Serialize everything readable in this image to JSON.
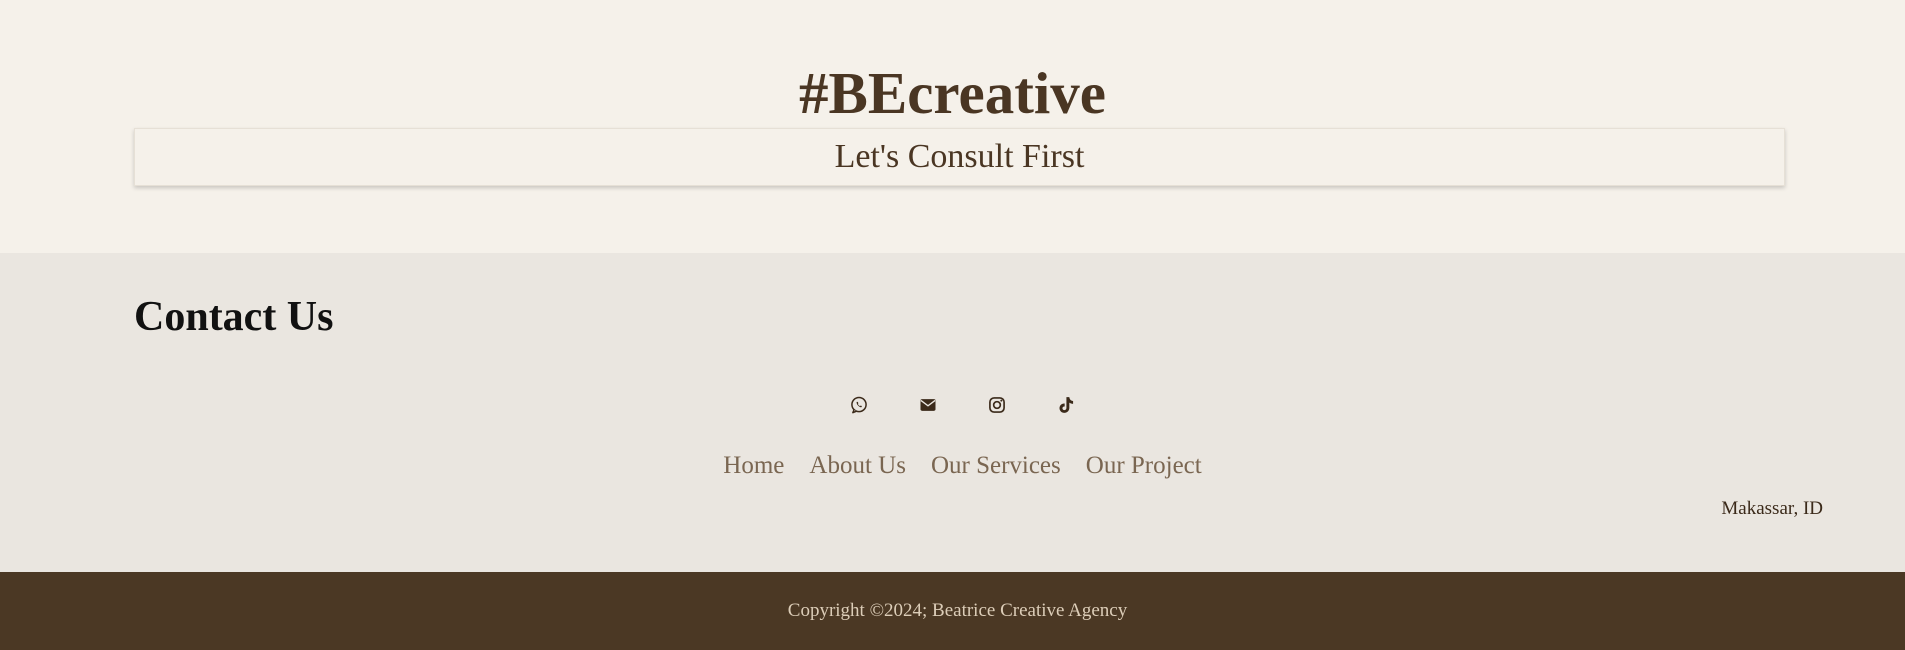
{
  "hero": {
    "title": "#BEcreative",
    "cta_label": "Let's Consult First"
  },
  "contact": {
    "heading": "Contact Us",
    "social": [
      {
        "icon": "whatsapp-icon"
      },
      {
        "icon": "envelope-icon"
      },
      {
        "icon": "instagram-icon"
      },
      {
        "icon": "tiktok-icon"
      }
    ],
    "nav": [
      "Home",
      "About Us",
      "Our Services",
      "Our Project"
    ],
    "location": "Makassar, ID"
  },
  "footer": {
    "copyright": "Copyright ©2024; Beatrice Creative Agency"
  },
  "colors": {
    "hero_bg": "#f5f1ea",
    "contact_bg": "#eae6e0",
    "footer_bg": "#4b3824",
    "brand_brown": "#4a3623",
    "nav_link": "#7a6651"
  }
}
